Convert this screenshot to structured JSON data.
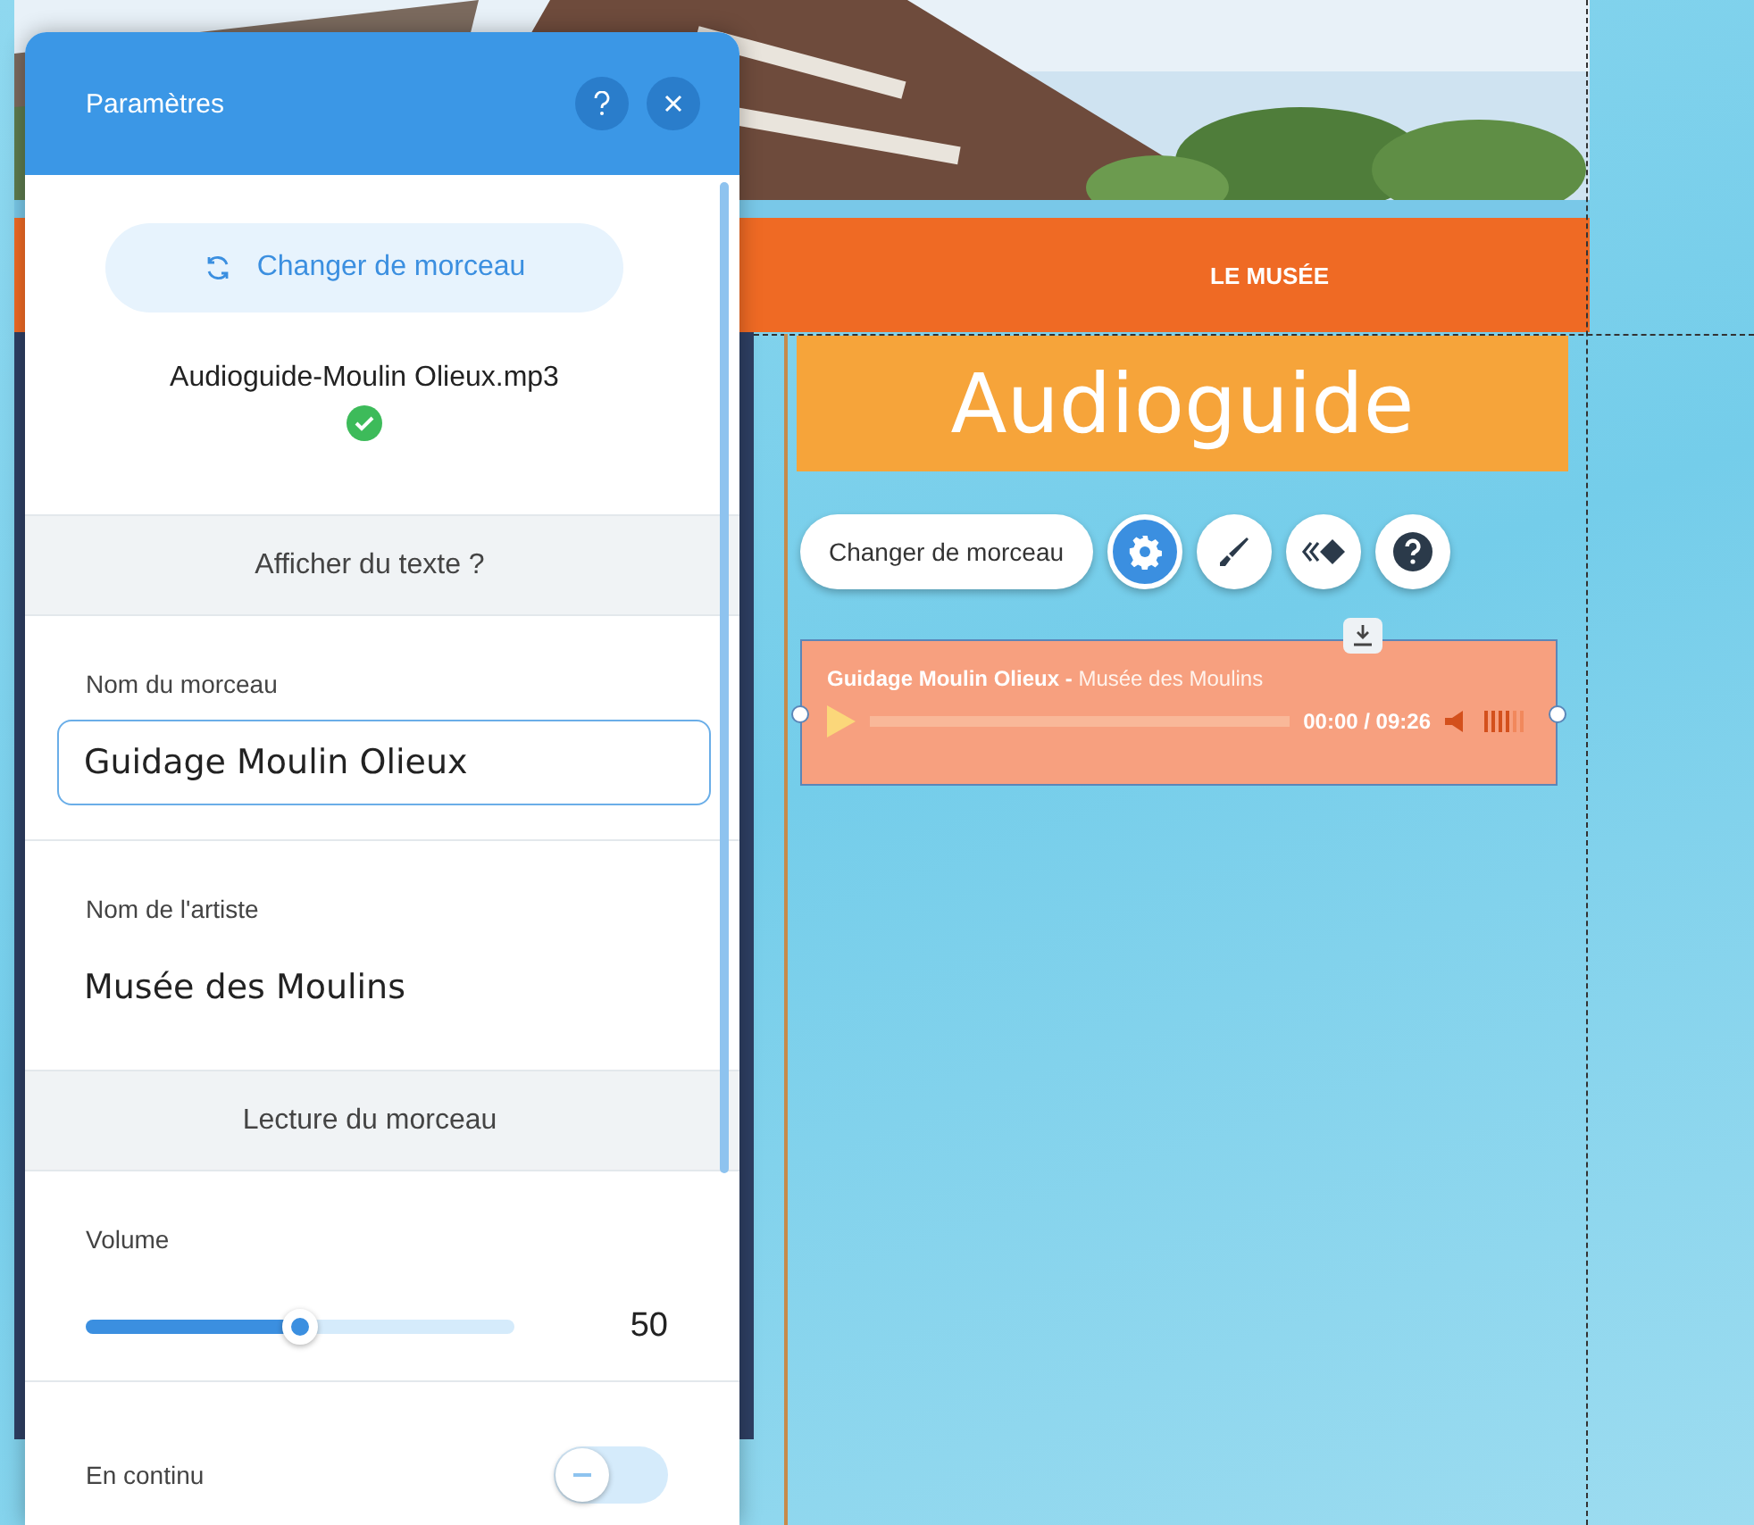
{
  "site": {
    "nav_item": "LE MUSÉE",
    "heading": "Audioguide",
    "toolbar": {
      "change_button": "Changer de morceau",
      "tools": [
        {
          "kind": "settings",
          "selected": true
        },
        {
          "kind": "design",
          "selected": false
        },
        {
          "kind": "animation",
          "selected": false
        },
        {
          "kind": "help",
          "selected": false
        }
      ]
    },
    "player": {
      "title": "Guidage Moulin Olieux",
      "separator": "-",
      "artist": "Musée des Moulins",
      "level": 0,
      "time": "00:00 / 09:26"
    }
  },
  "panel": {
    "title": "Paramètres",
    "change_button": "Changer de morceau",
    "file_name": "Audioguide-Moulin Olieux.mp3",
    "sections": [
      {
        "kind": "header",
        "label": "Afficher du texte ?"
      },
      {
        "kind": "input",
        "label": "Nom du morceau",
        "value": "Guidage Moulin Olieux",
        "focused": true
      },
      {
        "kind": "input",
        "label": "Nom de l'artiste",
        "value": "Musée des Moulins",
        "focused": false
      },
      {
        "kind": "header",
        "label": "Lecture du morceau"
      },
      {
        "kind": "slider",
        "label": "Volume",
        "level": 0.5,
        "reading": "50"
      },
      {
        "kind": "toggle",
        "label": "En continu",
        "on": false
      }
    ]
  }
}
